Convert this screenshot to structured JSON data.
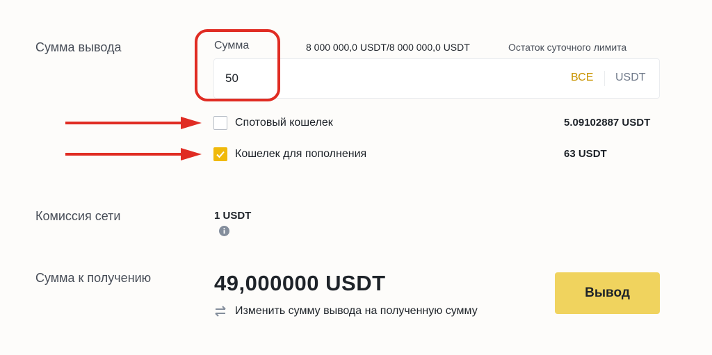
{
  "labels": {
    "withdraw_amount": "Сумма вывода",
    "network_fee": "Комиссия сети",
    "receive_amount": "Сумма к получению"
  },
  "amount": {
    "caption": "Сумма",
    "limit_value": "8 000 000,0 USDT/8 000 000,0 USDT",
    "limit_text": "Остаток суточного лимита",
    "input_value": "50",
    "all_label": "ВСЕ",
    "unit": "USDT"
  },
  "wallets": [
    {
      "label": "Спотовый кошелек",
      "balance": "5.09102887 USDT",
      "checked": false
    },
    {
      "label": "Кошелек для пополнения",
      "balance": "63 USDT",
      "checked": true
    }
  ],
  "fee": {
    "value": "1 USDT",
    "icon": "info-icon"
  },
  "receive": {
    "value": "49,000000 USDT",
    "switch_text": "Изменить сумму вывода на полученную сумму",
    "switch_icon": "swap-arrows-icon"
  },
  "actions": {
    "withdraw_label": "Вывод"
  },
  "colors": {
    "accent": "#f0b90b",
    "button": "#f0d35e",
    "all_link": "#c99400",
    "annotation": "#e02c23"
  }
}
